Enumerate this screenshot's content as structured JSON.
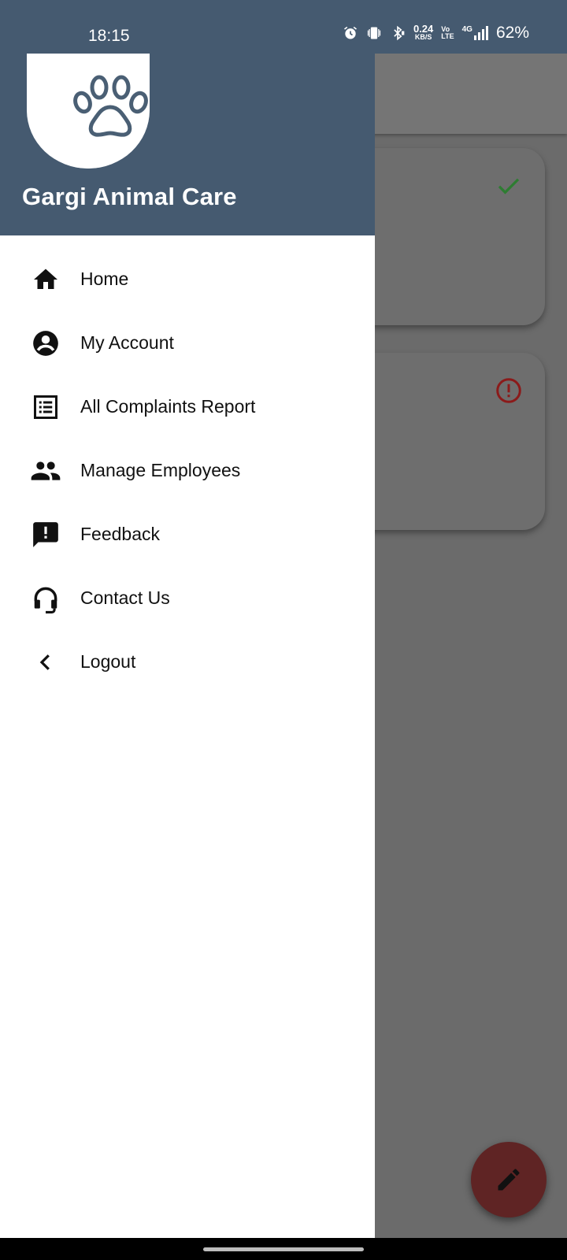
{
  "status_bar": {
    "time": "18:15",
    "net_speed_value": "0.24",
    "net_speed_unit": "KB/S",
    "volte_top": "Vo",
    "volte_bottom": "LTE",
    "network": "4G",
    "battery": "62%",
    "icons": [
      "alarm-icon",
      "vibrate-icon",
      "bluetooth-icon",
      "signal-icon"
    ]
  },
  "drawer": {
    "brand_name": "Gargi Animal Care",
    "logo_icon": "paw-icon",
    "items": [
      {
        "label": "Home",
        "icon": "home-icon"
      },
      {
        "label": "My Account",
        "icon": "account-circle-icon"
      },
      {
        "label": "All Complaints Report",
        "icon": "list-report-icon"
      },
      {
        "label": "Manage Employees",
        "icon": "people-icon"
      },
      {
        "label": "Feedback",
        "icon": "feedback-icon"
      },
      {
        "label": "Contact Us",
        "icon": "headset-icon"
      },
      {
        "label": "Logout",
        "icon": "chevron-left-icon"
      }
    ]
  },
  "background": {
    "cards": [
      {
        "status_icon": "check-icon",
        "status_color": "#2e7d32"
      },
      {
        "status_icon": "error-circle-icon",
        "status_color": "#8b1a1a"
      }
    ],
    "fab_icon": "edit-pencil-icon"
  },
  "colors": {
    "header": "#455a70",
    "scrim": "#6b6b6b"
  }
}
